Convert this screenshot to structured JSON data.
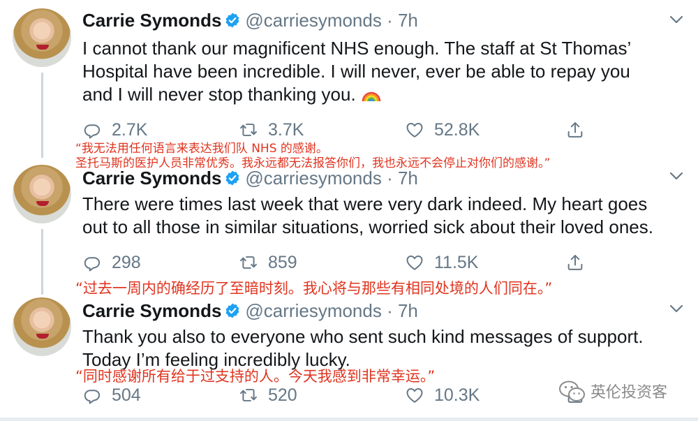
{
  "tweets": [
    {
      "name": "Carrie Symonds",
      "handle": "@carriesymonds",
      "time": "· 7h",
      "lines": [
        "I cannot thank our magnificent NHS enough. The staff at St Thomas’",
        "Hospital have been incredible. I will never, ever be able to repay you",
        "and I will never stop thanking you."
      ],
      "emoji": "rainbow-emoji",
      "replies": "2.7K",
      "retweets": "3.7K",
      "likes": "52.8K",
      "translation": [
        "“我无法用任何语言来表达我们队 NHS 的感谢。",
        "圣托马斯的医护人员非常优秀。我永远都无法报答你们，我也永远不会停止对你们的感谢。”"
      ]
    },
    {
      "name": "Carrie Symonds",
      "handle": "@carriesymonds",
      "time": "· 7h",
      "lines": [
        "There were times last week that were very dark indeed. My heart goes",
        "out to all those in similar situations, worried sick about their loved ones."
      ],
      "replies": "298",
      "retweets": "859",
      "likes": "11.5K",
      "translation": [
        "“过去一周内的确经历了至暗时刻。我心将与那些有相同处境的人们同在。”"
      ]
    },
    {
      "name": "Carrie Symonds",
      "handle": "@carriesymonds",
      "time": "· 7h",
      "lines": [
        "Thank you also to everyone who sent such kind messages of support.",
        "Today I’m feeling incredibly lucky."
      ],
      "replies": "504",
      "retweets": "520",
      "likes": "10.3K",
      "translation": [
        "“同时感谢所有给于过支持的人。今天我感到非常幸运。”"
      ]
    }
  ],
  "watermark": "英伦投资客",
  "colors": {
    "text": "#14171a",
    "muted": "#657786",
    "verified": "#1da1f2",
    "translation": "#e0341f",
    "thread_line": "#ccd6dd"
  }
}
